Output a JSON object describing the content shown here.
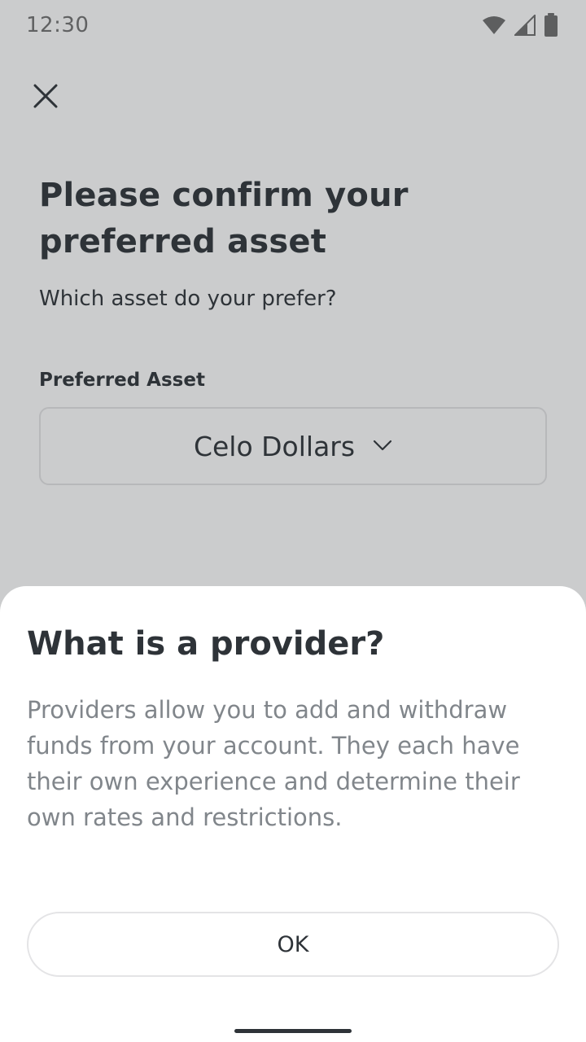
{
  "status_bar": {
    "time": "12:30",
    "icons": [
      "wifi-icon",
      "cell-signal-icon",
      "battery-icon"
    ]
  },
  "screen": {
    "close_icon": "close-icon",
    "title": "Please confirm your preferred asset",
    "subtitle": "Which asset do your prefer?",
    "field_label": "Preferred Asset",
    "selected_asset": "Celo Dollars",
    "dropdown_icon": "chevron-down-icon"
  },
  "sheet": {
    "title": "What is a provider?",
    "body": "Providers allow you to add and withdraw funds from your account. They each have their own experience and determine their own rates and restrictions.",
    "ok_label": "OK"
  },
  "colors": {
    "text_primary": "#2e3338",
    "text_secondary": "#81868b",
    "border": "#e4e4e6",
    "scrim": "#2e3338"
  }
}
